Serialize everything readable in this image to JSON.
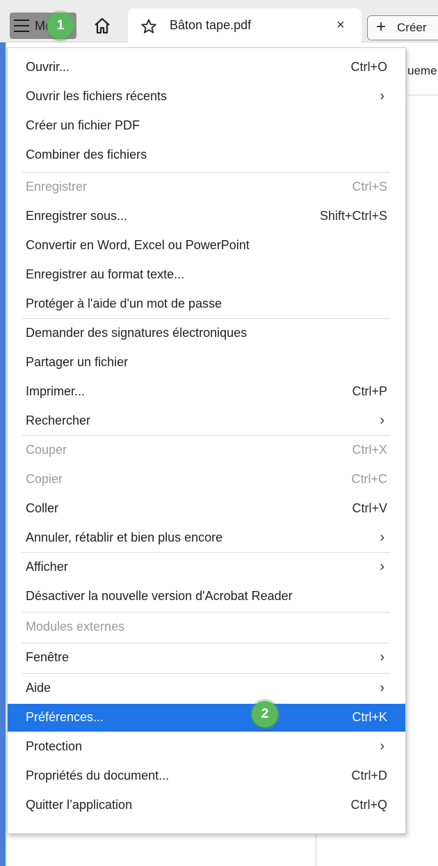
{
  "topbar": {
    "menu_label": "Menu",
    "badge_1": "1",
    "tab_title": "Bâton tape.pdf",
    "tab_close": "×",
    "create_plus": "+",
    "create_label": "Créer"
  },
  "background": {
    "partial_text": "ueme"
  },
  "menu": {
    "items": [
      {
        "label": "Ouvrir...",
        "shortcut": "Ctrl+O"
      },
      {
        "label": "Ouvrir les fichiers récents",
        "submenu": "›"
      },
      {
        "label": "Créer un fichier PDF"
      },
      {
        "label": "Combiner des fichiers"
      },
      {
        "label": "Enregistrer",
        "shortcut": "Ctrl+S",
        "disabled": true
      },
      {
        "label": "Enregistrer sous...",
        "shortcut": "Shift+Ctrl+S"
      },
      {
        "label": "Convertir en Word, Excel ou PowerPoint"
      },
      {
        "label": "Enregistrer au format texte..."
      },
      {
        "label": "Protéger à l'aide d'un mot de passe"
      },
      {
        "label": "Demander des signatures électroniques"
      },
      {
        "label": "Partager un fichier"
      },
      {
        "label": "Imprimer...",
        "shortcut": "Ctrl+P"
      },
      {
        "label": "Rechercher",
        "submenu": "›"
      },
      {
        "label": "Couper",
        "shortcut": "Ctrl+X",
        "disabled": true
      },
      {
        "label": "Copier",
        "shortcut": "Ctrl+C",
        "disabled": true
      },
      {
        "label": "Coller",
        "shortcut": "Ctrl+V"
      },
      {
        "label": "Annuler, rétablir et bien plus encore",
        "submenu": "›"
      },
      {
        "label": "Afficher",
        "submenu": "›"
      },
      {
        "label": "Désactiver la nouvelle version d'Acrobat Reader"
      },
      {
        "label": "Modules externes",
        "disabled": true
      },
      {
        "label": "Fenêtre",
        "submenu": "›"
      },
      {
        "label": "Aide",
        "submenu": "›"
      },
      {
        "label": "Préférences...",
        "shortcut": "Ctrl+K",
        "selected": true
      },
      {
        "label": "Protection",
        "submenu": "›"
      },
      {
        "label": "Propriétés du document...",
        "shortcut": "Ctrl+D"
      },
      {
        "label": "Quitter l’application",
        "shortcut": "Ctrl+Q"
      }
    ],
    "badge_2": "2"
  },
  "icons": {
    "menu": "hamburger-icon",
    "home": "home-icon",
    "favorite": "star-icon",
    "close": "close-icon",
    "create": "plus-icon",
    "submenu": "chevron-right-icon"
  },
  "colors": {
    "selected_bg": "#1f74e8",
    "badge_green": "#5cb85c",
    "disabled_text": "#9a9a9a",
    "accent_edge": "#4a7fd6"
  }
}
